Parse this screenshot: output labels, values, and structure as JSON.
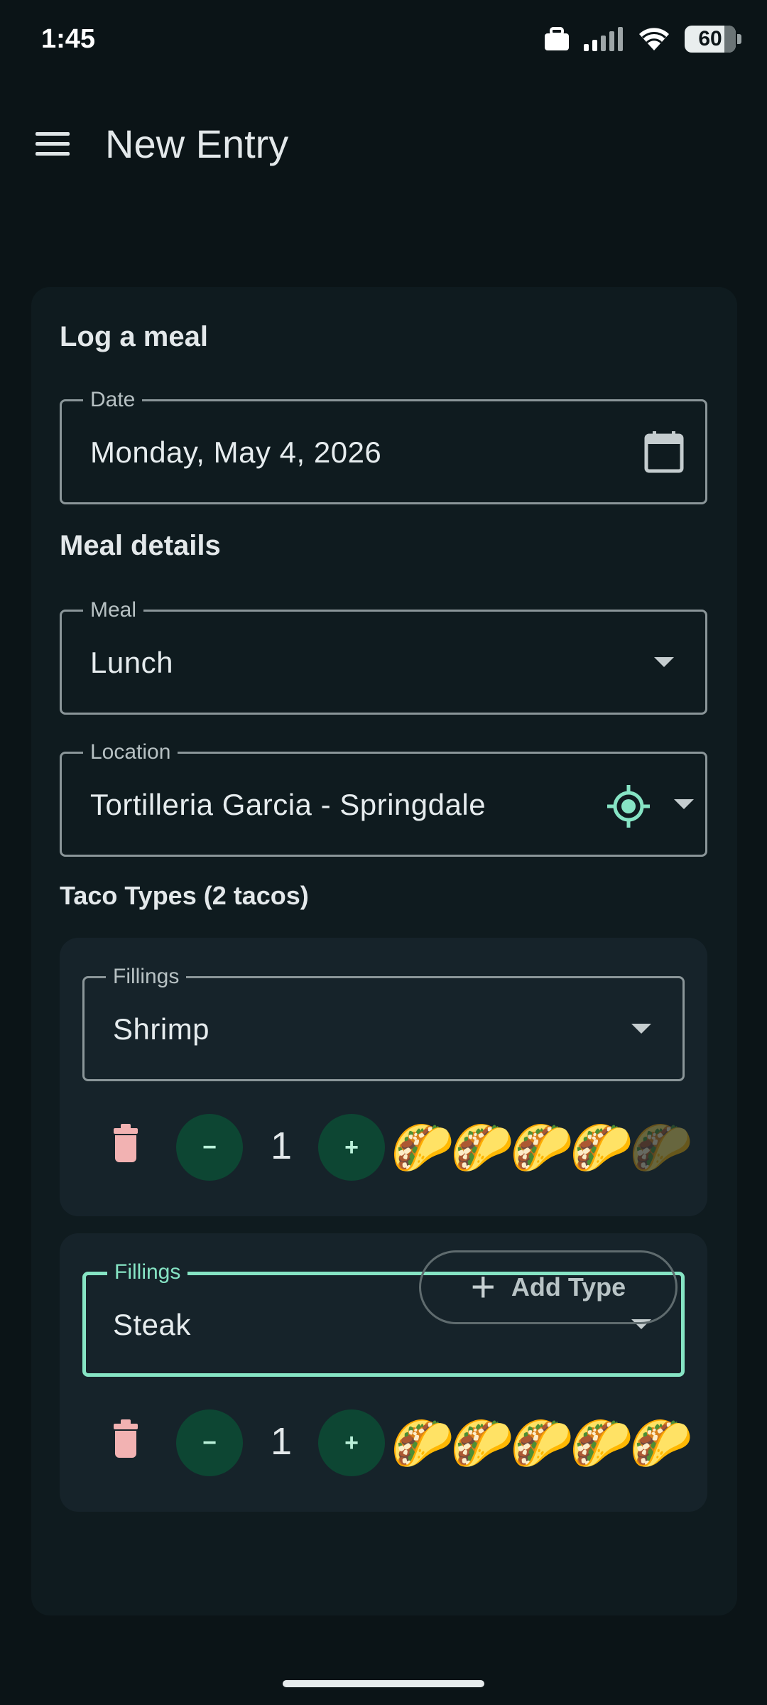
{
  "status_bar": {
    "time": "1:45",
    "battery": "60",
    "icons": [
      "briefcase-icon",
      "signal-icon",
      "wifi-icon",
      "battery-icon"
    ]
  },
  "app_bar": {
    "title": "New Entry",
    "menu_icon": "menu-icon"
  },
  "form": {
    "title": "Log a meal",
    "date": {
      "label": "Date",
      "value": "Monday, May 4, 2026",
      "icon": "calendar-icon"
    },
    "meal_details_title": "Meal details",
    "meal": {
      "label": "Meal",
      "value": "Lunch"
    },
    "location": {
      "label": "Location",
      "value": "Tortilleria Garcia - Springdale",
      "icon": "my-location-icon"
    },
    "taco_types_title": "Taco Types (2 tacos)",
    "taco_types": [
      {
        "fillings_label": "Fillings",
        "filling": "Shrimp",
        "quantity": "1",
        "rating": 4,
        "rating_max": 5
      },
      {
        "fillings_label": "Fillings",
        "filling": "Steak",
        "quantity": "1",
        "rating": 5,
        "rating_max": 5
      }
    ],
    "decrement_label": "−",
    "increment_label": "+",
    "add_type_label": "Add Type"
  },
  "colors": {
    "background": "#0b1417",
    "card": "#0f1b1f",
    "accent": "#86e4c4",
    "button_fill": "#0d4633",
    "delete": "#f2b2b2"
  }
}
